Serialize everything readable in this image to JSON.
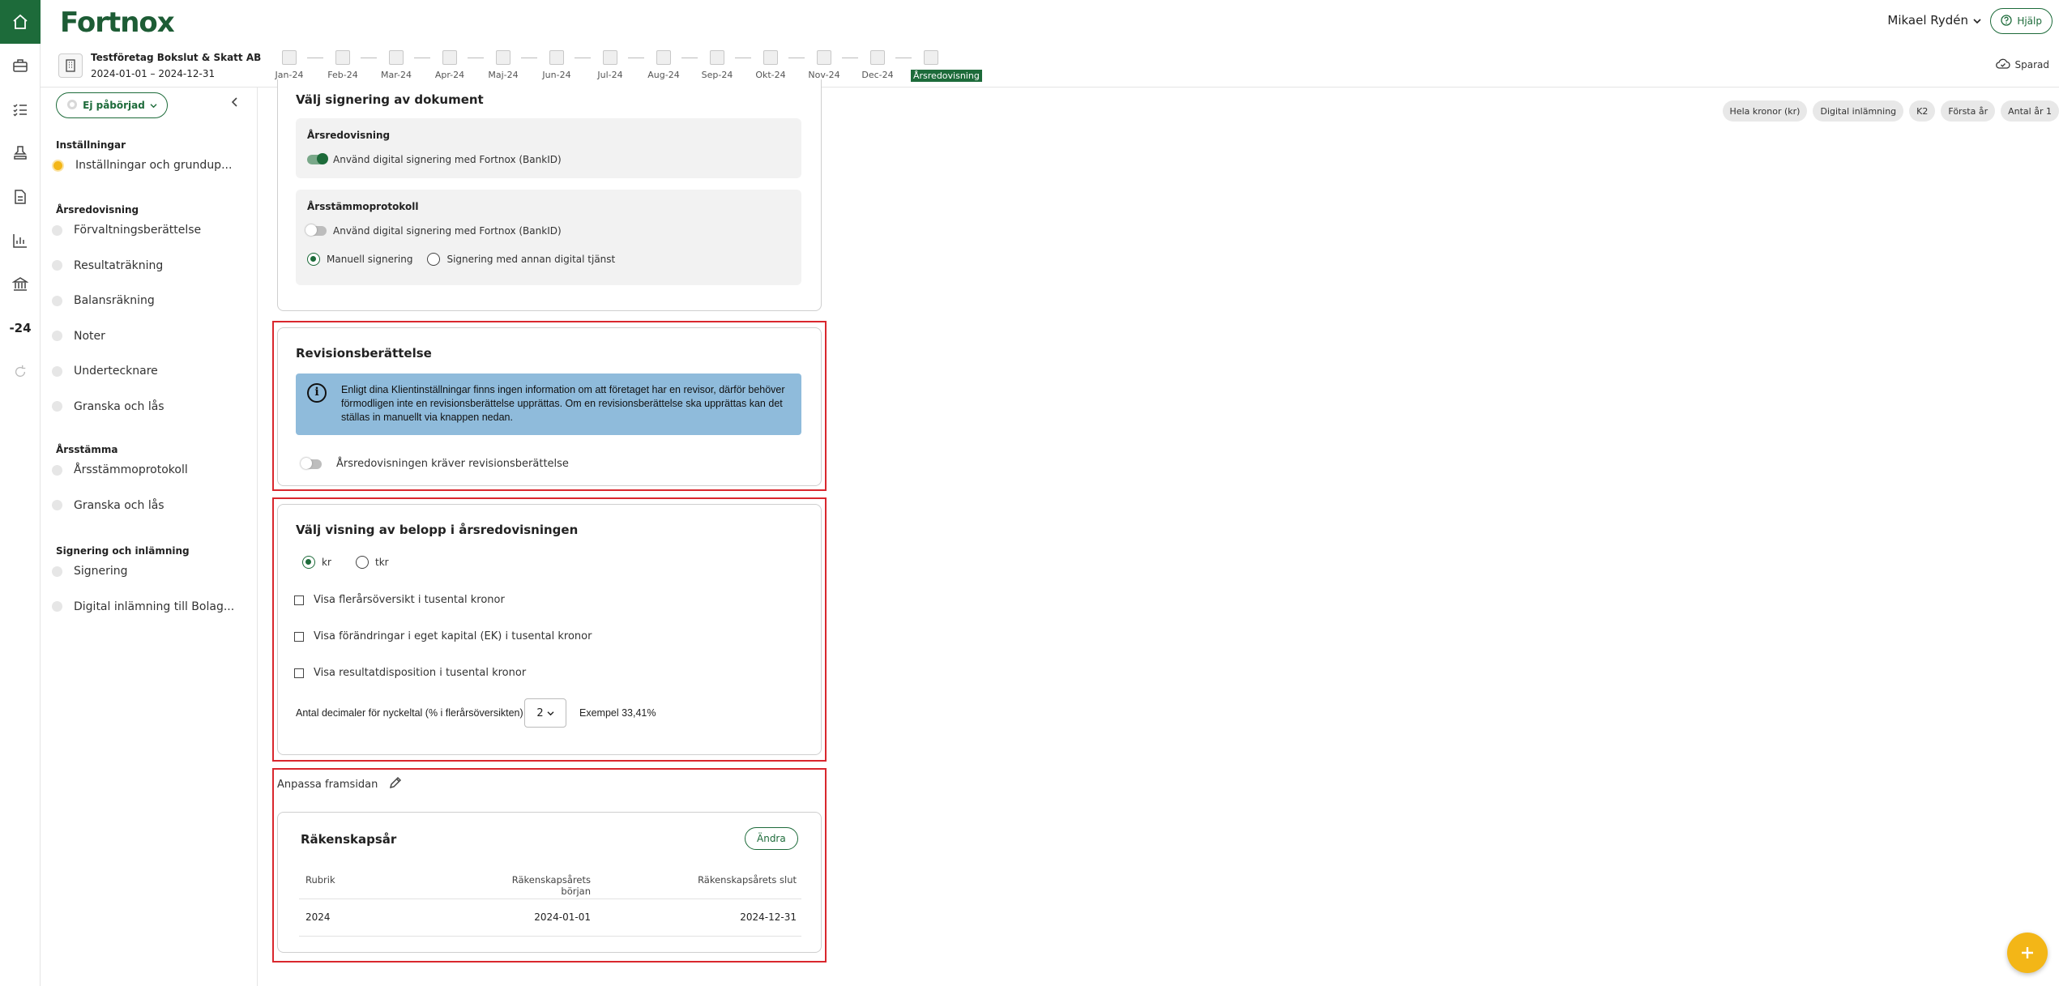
{
  "app": {
    "logo": "Fortnox",
    "user": "Mikael Rydén",
    "help_label": "Hjälp",
    "saved_label": "Sparad"
  },
  "rail": {
    "year_label": "-24"
  },
  "company": {
    "name": "Testföretag Bokslut & Skatt AB",
    "period": "2024-01-01 – 2024-12-31"
  },
  "months": [
    "Jan-24",
    "Feb-24",
    "Mar-24",
    "Apr-24",
    "Maj-24",
    "Jun-24",
    "Jul-24",
    "Aug-24",
    "Sep-24",
    "Okt-24",
    "Nov-24",
    "Dec-24",
    "Årsredovisning"
  ],
  "sidebar": {
    "status": "Ej påbörjad",
    "sections": [
      {
        "title": "Inställningar",
        "items": [
          "Inställningar och grundup..."
        ]
      },
      {
        "title": "Årsredovisning",
        "items": [
          "Förvaltningsberättelse",
          "Resultaträkning",
          "Balansräkning",
          "Noter",
          "Undertecknare",
          "Granska och lås"
        ]
      },
      {
        "title": "Årsstämma",
        "items": [
          "Årsstämmoprotokoll",
          "Granska och lås"
        ]
      },
      {
        "title": "Signering och inlämning",
        "items": [
          "Signering",
          "Digital inlämning till Bolag..."
        ]
      }
    ]
  },
  "chips": [
    "Hela kronor (kr)",
    "Digital inlämning",
    "K2",
    "Första år",
    "Antal år 1"
  ],
  "signing": {
    "title": "Välj signering av dokument",
    "annual_report": {
      "title": "Årsredovisning",
      "toggle_label": "Använd digital signering med Fortnox (BankID)"
    },
    "meeting_protocol": {
      "title": "Årsstämmoprotokoll",
      "toggle_label": "Använd digital signering med Fortnox (BankID)",
      "radio_manual": "Manuell signering",
      "radio_other": "Signering med annan digital tjänst"
    }
  },
  "audit": {
    "title": "Revisionsberättelse",
    "info": "Enligt dina Klientinställningar finns ingen information om att företaget har en revisor, därför behöver förmodligen inte en revisionsberättelse upprättas. Om en revisionsberättelse ska upprättas kan det ställas in manuellt via knappen nedan.",
    "toggle_label": "Årsredovisningen kräver revisionsberättelse"
  },
  "amounts": {
    "title": "Välj visning av belopp i årsredovisningen",
    "radio_kr": "kr",
    "radio_tkr": "tkr",
    "cb1": "Visa flerårsöversikt i tusental kronor",
    "cb2": "Visa förändringar i eget kapital (EK) i tusental kronor",
    "cb3": "Visa resultatdisposition i tusental kronor",
    "decimals_label": "Antal decimaler för nyckeltal (% i flerårsöversikten)",
    "decimals_value": "2",
    "example": "Exempel 33,41%"
  },
  "cover": {
    "label": "Anpassa framsidan",
    "card_title": "Räkenskapsår",
    "change_label": "Ändra",
    "headers": [
      "Rubrik",
      "Räkenskapsårets början",
      "Räkenskapsårets slut"
    ],
    "row": [
      "2024",
      "2024-01-01",
      "2024-12-31"
    ]
  },
  "colors": {
    "brand": "#1d6b3a",
    "accent": "#f3b617",
    "highlight": "#d9272e",
    "info": "#8fbbdb"
  }
}
